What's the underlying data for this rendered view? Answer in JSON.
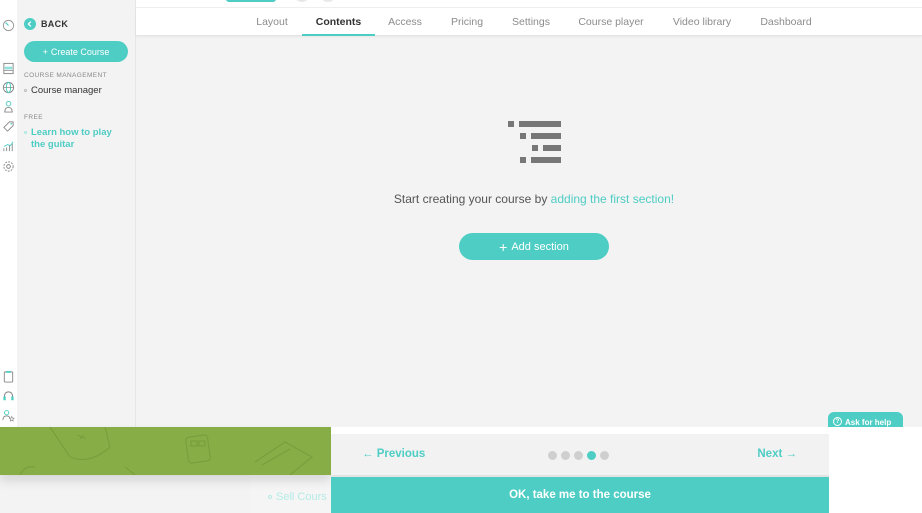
{
  "sidebar": {
    "back_label": "BACK",
    "create_button": "Create Course",
    "sections": [
      {
        "title": "COURSE MANAGEMENT",
        "items": [
          {
            "label": "Course manager",
            "active": false
          }
        ]
      },
      {
        "title": "FREE",
        "items": [
          {
            "label": "Learn how to play the guitar",
            "active": true
          }
        ]
      }
    ]
  },
  "rail_icons": [
    "clock-icon",
    "calculator-icon",
    "globe-icon",
    "user-location-icon",
    "tag-icon",
    "chart-icon",
    "gear-icon",
    "clipboard-icon",
    "headset-icon",
    "users-star-icon"
  ],
  "tabs": [
    {
      "label": "Layout",
      "active": false
    },
    {
      "label": "Contents",
      "active": true
    },
    {
      "label": "Access",
      "active": false
    },
    {
      "label": "Pricing",
      "active": false
    },
    {
      "label": "Settings",
      "active": false
    },
    {
      "label": "Course player",
      "active": false
    },
    {
      "label": "Video library",
      "active": false
    },
    {
      "label": "Dashboard",
      "active": false
    }
  ],
  "empty_state": {
    "text_prefix": "Start creating your course by ",
    "link_text": "adding the first section!",
    "add_button": "Add section"
  },
  "help": {
    "label": "Ask for help"
  },
  "onboarding": {
    "previous_label": "← Previous",
    "next_label": "Next →",
    "total_steps": 5,
    "current_step": 4,
    "ok_button": "OK, take me to the course",
    "background_item": "Sell Cours"
  },
  "colors": {
    "accent": "#4ecdc4",
    "onboarding_green": "#86ad46"
  }
}
